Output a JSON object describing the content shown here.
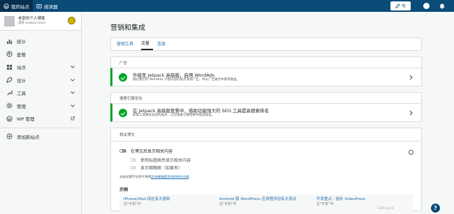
{
  "topbar": {
    "my_site": "我的站点",
    "reader": "阅读器",
    "write": "写"
  },
  "sidebar": {
    "site_name": "老郭的个人博客",
    "site_url": "澳客 waibao.team",
    "items": [
      {
        "label": "统计",
        "icon": "bar-chart-icon",
        "chevron": false
      },
      {
        "label": "套餐",
        "icon": "plans-icon",
        "chevron": false
      },
      {
        "label": "站点",
        "icon": "site-icon",
        "chevron": true
      },
      {
        "label": "设计",
        "icon": "design-icon",
        "chevron": true
      },
      {
        "label": "工具",
        "icon": "tools-icon",
        "chevron": true
      },
      {
        "label": "管理",
        "icon": "manage-icon",
        "chevron": true
      },
      {
        "label": "WP 管理",
        "icon": "wordpress-icon",
        "chevron": false
      }
    ],
    "add_site": "添加新站点"
  },
  "main": {
    "title": "营销和集成",
    "tabs": [
      {
        "label": "营销工具",
        "active": false
      },
      {
        "label": "流量",
        "active": true
      },
      {
        "label": "连接",
        "active": false
      }
    ],
    "ads": {
      "header": "广告",
      "title": "升级至 Jetpack 高级版，启用 WordAds",
      "desc": "通过我们的 WordAds 计划向您的站点添加广告，并从广告展示中获得收益。"
    },
    "seo": {
      "header": "搜索引擎优化",
      "title": "在 Jetpack 高级版套餐中，借助功能强大的 SEO 工具提高搜索排名",
      "desc": "获取工具来优化您的站点，以在搜索引擎结果中提高排名。"
    },
    "related": {
      "header": "相关博文",
      "opt_main": "在博文后显示相关内容",
      "opt_sub1": "使用标题高亮显示相关内容",
      "opt_sub2": "显示缩略图（如果有）",
      "note_prefix": "这些设置不适用于使用",
      "note_link": "区块编辑器添加的相关文章",
      "note_suffix": "。",
      "example_label": "示例",
      "examples": [
        {
          "title": "iPhone/iPad 现在有大更新",
          "sub": "在\"手机\"中"
        },
        {
          "title": "Android 版 WordPress 应用程序迎有大变动",
          "sub": "在\"手机\"中"
        },
        {
          "title": "开发重点：插补 VideoPress",
          "sub": "在\"开发\"中"
        }
      ]
    }
  },
  "help": "?",
  "watermark": "CSDN @小K"
}
